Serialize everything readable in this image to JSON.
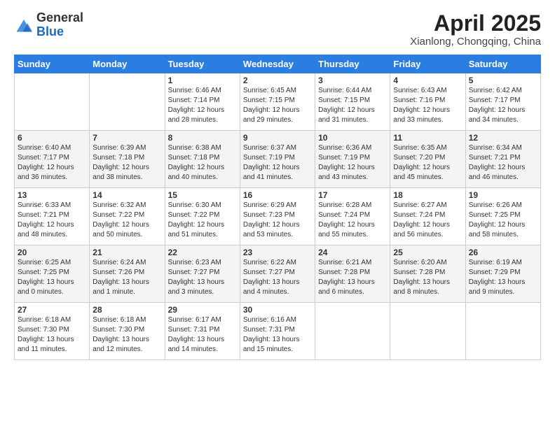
{
  "logo": {
    "general": "General",
    "blue": "Blue"
  },
  "header": {
    "month": "April 2025",
    "location": "Xianlong, Chongqing, China"
  },
  "days_of_week": [
    "Sunday",
    "Monday",
    "Tuesday",
    "Wednesday",
    "Thursday",
    "Friday",
    "Saturday"
  ],
  "weeks": [
    [
      {
        "day": "",
        "info": ""
      },
      {
        "day": "",
        "info": ""
      },
      {
        "day": "1",
        "info": "Sunrise: 6:46 AM\nSunset: 7:14 PM\nDaylight: 12 hours and 28 minutes."
      },
      {
        "day": "2",
        "info": "Sunrise: 6:45 AM\nSunset: 7:15 PM\nDaylight: 12 hours and 29 minutes."
      },
      {
        "day": "3",
        "info": "Sunrise: 6:44 AM\nSunset: 7:15 PM\nDaylight: 12 hours and 31 minutes."
      },
      {
        "day": "4",
        "info": "Sunrise: 6:43 AM\nSunset: 7:16 PM\nDaylight: 12 hours and 33 minutes."
      },
      {
        "day": "5",
        "info": "Sunrise: 6:42 AM\nSunset: 7:17 PM\nDaylight: 12 hours and 34 minutes."
      }
    ],
    [
      {
        "day": "6",
        "info": "Sunrise: 6:40 AM\nSunset: 7:17 PM\nDaylight: 12 hours and 36 minutes."
      },
      {
        "day": "7",
        "info": "Sunrise: 6:39 AM\nSunset: 7:18 PM\nDaylight: 12 hours and 38 minutes."
      },
      {
        "day": "8",
        "info": "Sunrise: 6:38 AM\nSunset: 7:18 PM\nDaylight: 12 hours and 40 minutes."
      },
      {
        "day": "9",
        "info": "Sunrise: 6:37 AM\nSunset: 7:19 PM\nDaylight: 12 hours and 41 minutes."
      },
      {
        "day": "10",
        "info": "Sunrise: 6:36 AM\nSunset: 7:19 PM\nDaylight: 12 hours and 43 minutes."
      },
      {
        "day": "11",
        "info": "Sunrise: 6:35 AM\nSunset: 7:20 PM\nDaylight: 12 hours and 45 minutes."
      },
      {
        "day": "12",
        "info": "Sunrise: 6:34 AM\nSunset: 7:21 PM\nDaylight: 12 hours and 46 minutes."
      }
    ],
    [
      {
        "day": "13",
        "info": "Sunrise: 6:33 AM\nSunset: 7:21 PM\nDaylight: 12 hours and 48 minutes."
      },
      {
        "day": "14",
        "info": "Sunrise: 6:32 AM\nSunset: 7:22 PM\nDaylight: 12 hours and 50 minutes."
      },
      {
        "day": "15",
        "info": "Sunrise: 6:30 AM\nSunset: 7:22 PM\nDaylight: 12 hours and 51 minutes."
      },
      {
        "day": "16",
        "info": "Sunrise: 6:29 AM\nSunset: 7:23 PM\nDaylight: 12 hours and 53 minutes."
      },
      {
        "day": "17",
        "info": "Sunrise: 6:28 AM\nSunset: 7:24 PM\nDaylight: 12 hours and 55 minutes."
      },
      {
        "day": "18",
        "info": "Sunrise: 6:27 AM\nSunset: 7:24 PM\nDaylight: 12 hours and 56 minutes."
      },
      {
        "day": "19",
        "info": "Sunrise: 6:26 AM\nSunset: 7:25 PM\nDaylight: 12 hours and 58 minutes."
      }
    ],
    [
      {
        "day": "20",
        "info": "Sunrise: 6:25 AM\nSunset: 7:25 PM\nDaylight: 13 hours and 0 minutes."
      },
      {
        "day": "21",
        "info": "Sunrise: 6:24 AM\nSunset: 7:26 PM\nDaylight: 13 hours and 1 minute."
      },
      {
        "day": "22",
        "info": "Sunrise: 6:23 AM\nSunset: 7:27 PM\nDaylight: 13 hours and 3 minutes."
      },
      {
        "day": "23",
        "info": "Sunrise: 6:22 AM\nSunset: 7:27 PM\nDaylight: 13 hours and 4 minutes."
      },
      {
        "day": "24",
        "info": "Sunrise: 6:21 AM\nSunset: 7:28 PM\nDaylight: 13 hours and 6 minutes."
      },
      {
        "day": "25",
        "info": "Sunrise: 6:20 AM\nSunset: 7:28 PM\nDaylight: 13 hours and 8 minutes."
      },
      {
        "day": "26",
        "info": "Sunrise: 6:19 AM\nSunset: 7:29 PM\nDaylight: 13 hours and 9 minutes."
      }
    ],
    [
      {
        "day": "27",
        "info": "Sunrise: 6:18 AM\nSunset: 7:30 PM\nDaylight: 13 hours and 11 minutes."
      },
      {
        "day": "28",
        "info": "Sunrise: 6:18 AM\nSunset: 7:30 PM\nDaylight: 13 hours and 12 minutes."
      },
      {
        "day": "29",
        "info": "Sunrise: 6:17 AM\nSunset: 7:31 PM\nDaylight: 13 hours and 14 minutes."
      },
      {
        "day": "30",
        "info": "Sunrise: 6:16 AM\nSunset: 7:31 PM\nDaylight: 13 hours and 15 minutes."
      },
      {
        "day": "",
        "info": ""
      },
      {
        "day": "",
        "info": ""
      },
      {
        "day": "",
        "info": ""
      }
    ]
  ]
}
